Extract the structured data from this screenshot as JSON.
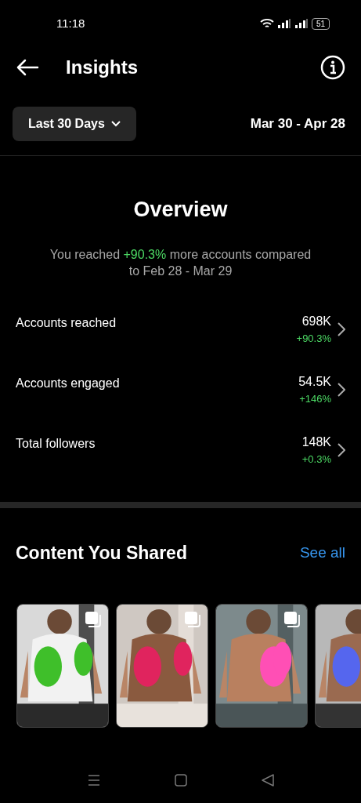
{
  "status_bar": {
    "time": "11:18",
    "battery": "51"
  },
  "header": {
    "title": "Insights"
  },
  "filter": {
    "label": "Last 30 Days",
    "date_range": "Mar 30 - Apr 28"
  },
  "overview": {
    "title": "Overview",
    "summary_before": "You reached ",
    "summary_highlight": "+90.3%",
    "summary_after": " more accounts compared to Feb 28 - Mar 29"
  },
  "metrics": [
    {
      "label": "Accounts reached",
      "value": "698K",
      "change": "+90.3%"
    },
    {
      "label": "Accounts engaged",
      "value": "54.5K",
      "change": "+146%"
    },
    {
      "label": "Total followers",
      "value": "148K",
      "change": "+0.3%"
    }
  ],
  "content": {
    "title": "Content You Shared",
    "see_all": "See all"
  }
}
